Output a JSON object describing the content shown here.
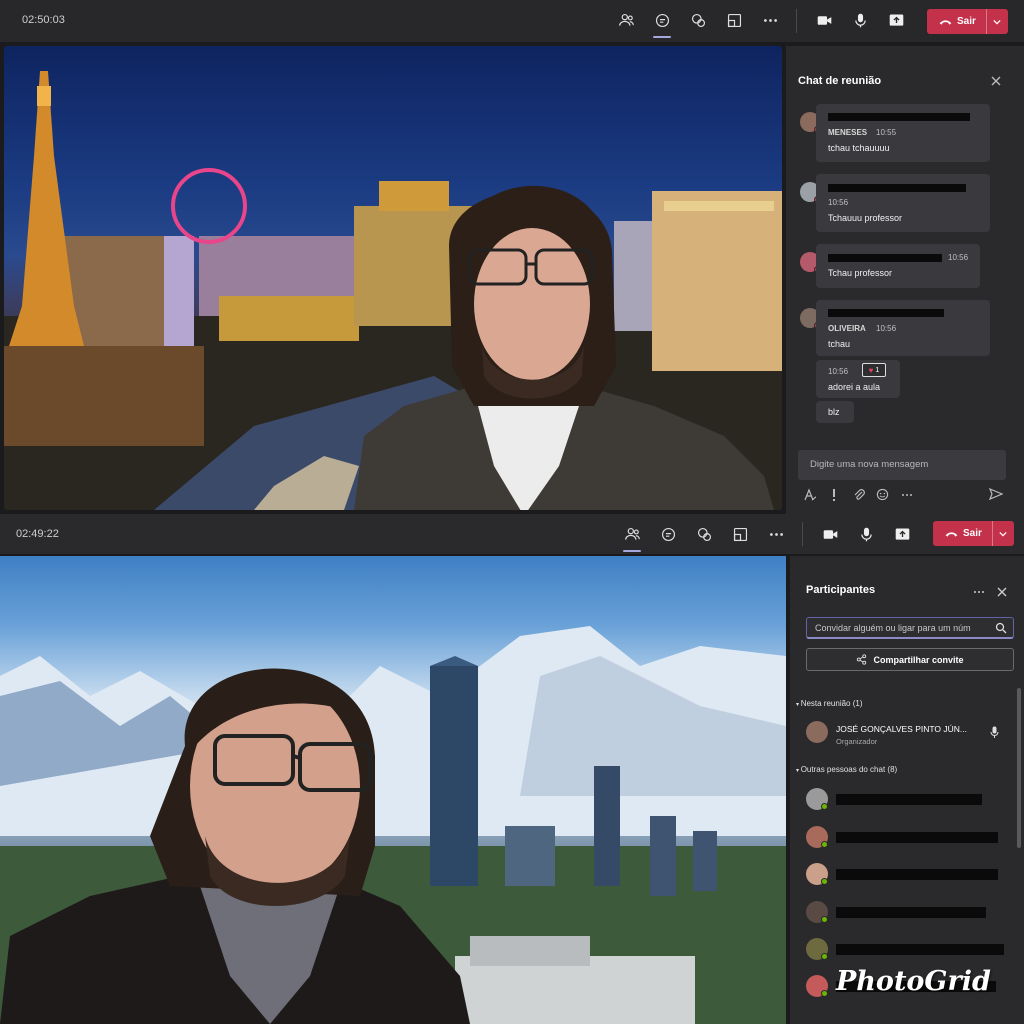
{
  "colors": {
    "accent": "#6264a7",
    "leave": "#c4314b",
    "panel": "#2a2a2d",
    "toolbar": "#28282b",
    "online": "#6bb700"
  },
  "top": {
    "time": "02:50:03",
    "leave_label": "Sair",
    "chat": {
      "title": "Chat de reunião",
      "messages": [
        {
          "sender": "MENESES",
          "time": "10:55",
          "text": "tchau tchauuuu"
        },
        {
          "sender": "",
          "time": "10:56",
          "text": "Tchauuu professor"
        },
        {
          "sender": "",
          "time": "10:56",
          "text": "Tchau professor"
        },
        {
          "sender": "OLIVEIRA",
          "time": "10:56",
          "text": "tchau"
        },
        {
          "sender": "",
          "time": "10:56",
          "text": "adorei a aula",
          "reaction_count": "1"
        },
        {
          "sender": "",
          "time": "",
          "text": "blz"
        }
      ],
      "compose_placeholder": "Digite uma nova mensagem"
    }
  },
  "bottom": {
    "time": "02:49:22",
    "leave_label": "Sair",
    "participants": {
      "title": "Participantes",
      "search_placeholder": "Convidar alguém ou ligar para um núm",
      "share_label": "Compartilhar convite",
      "in_meeting_label": "Nesta reunião (1)",
      "organizer": {
        "name": "JOSÉ GONÇALVES PINTO JÚN...",
        "role": "Organizador"
      },
      "others_label": "Outras pessoas do chat (8)"
    }
  },
  "watermark": "PhotoGrid",
  "icons": [
    "participants-icon",
    "chat-icon",
    "reactions-icon",
    "share-screen-icon",
    "more-icon",
    "camera-icon",
    "mic-icon",
    "share-tray-icon",
    "phone-icon",
    "chevron-down-icon",
    "close-icon",
    "send-icon",
    "format-icon",
    "attach-icon",
    "emoji-icon",
    "search-icon",
    "share-icon"
  ]
}
